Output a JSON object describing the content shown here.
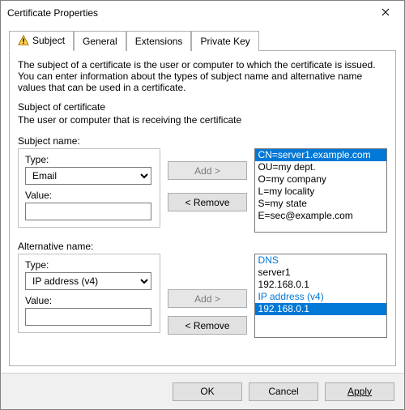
{
  "window": {
    "title": "Certificate Properties"
  },
  "tabs": [
    "Subject",
    "General",
    "Extensions",
    "Private Key"
  ],
  "active_tab": 0,
  "body": {
    "description": "The subject of a certificate is the user or computer to which the certificate is issued. You can enter information about the types of subject name and alternative name values that can be used in a certificate.",
    "subject_header": "Subject of certificate",
    "subject_subdesc": "The user or computer that is receiving the certificate",
    "subject_name_label": "Subject name:",
    "alternative_name_label": "Alternative name:"
  },
  "subject": {
    "type_label": "Type:",
    "type_value": "Email",
    "value_label": "Value:",
    "value_text": "",
    "add_label": "Add >",
    "remove_label": "< Remove",
    "list": [
      "CN=server1.example.com",
      "OU=my dept.",
      "O=my company",
      "L=my locality",
      "S=my state",
      "E=sec@example.com"
    ],
    "selected_index": 0
  },
  "altname": {
    "type_label": "Type:",
    "type_value": "IP address (v4)",
    "value_label": "Value:",
    "value_text": "",
    "add_label": "Add >",
    "remove_label": "< Remove",
    "groups": [
      {
        "header": "DNS",
        "items": [
          "server1",
          "192.168.0.1"
        ]
      },
      {
        "header": "IP address (v4)",
        "items": [
          "192.168.0.1"
        ]
      }
    ],
    "selected": {
      "group": 1,
      "item": 0
    }
  },
  "buttons": {
    "ok": "OK",
    "cancel": "Cancel",
    "apply": "Apply"
  }
}
